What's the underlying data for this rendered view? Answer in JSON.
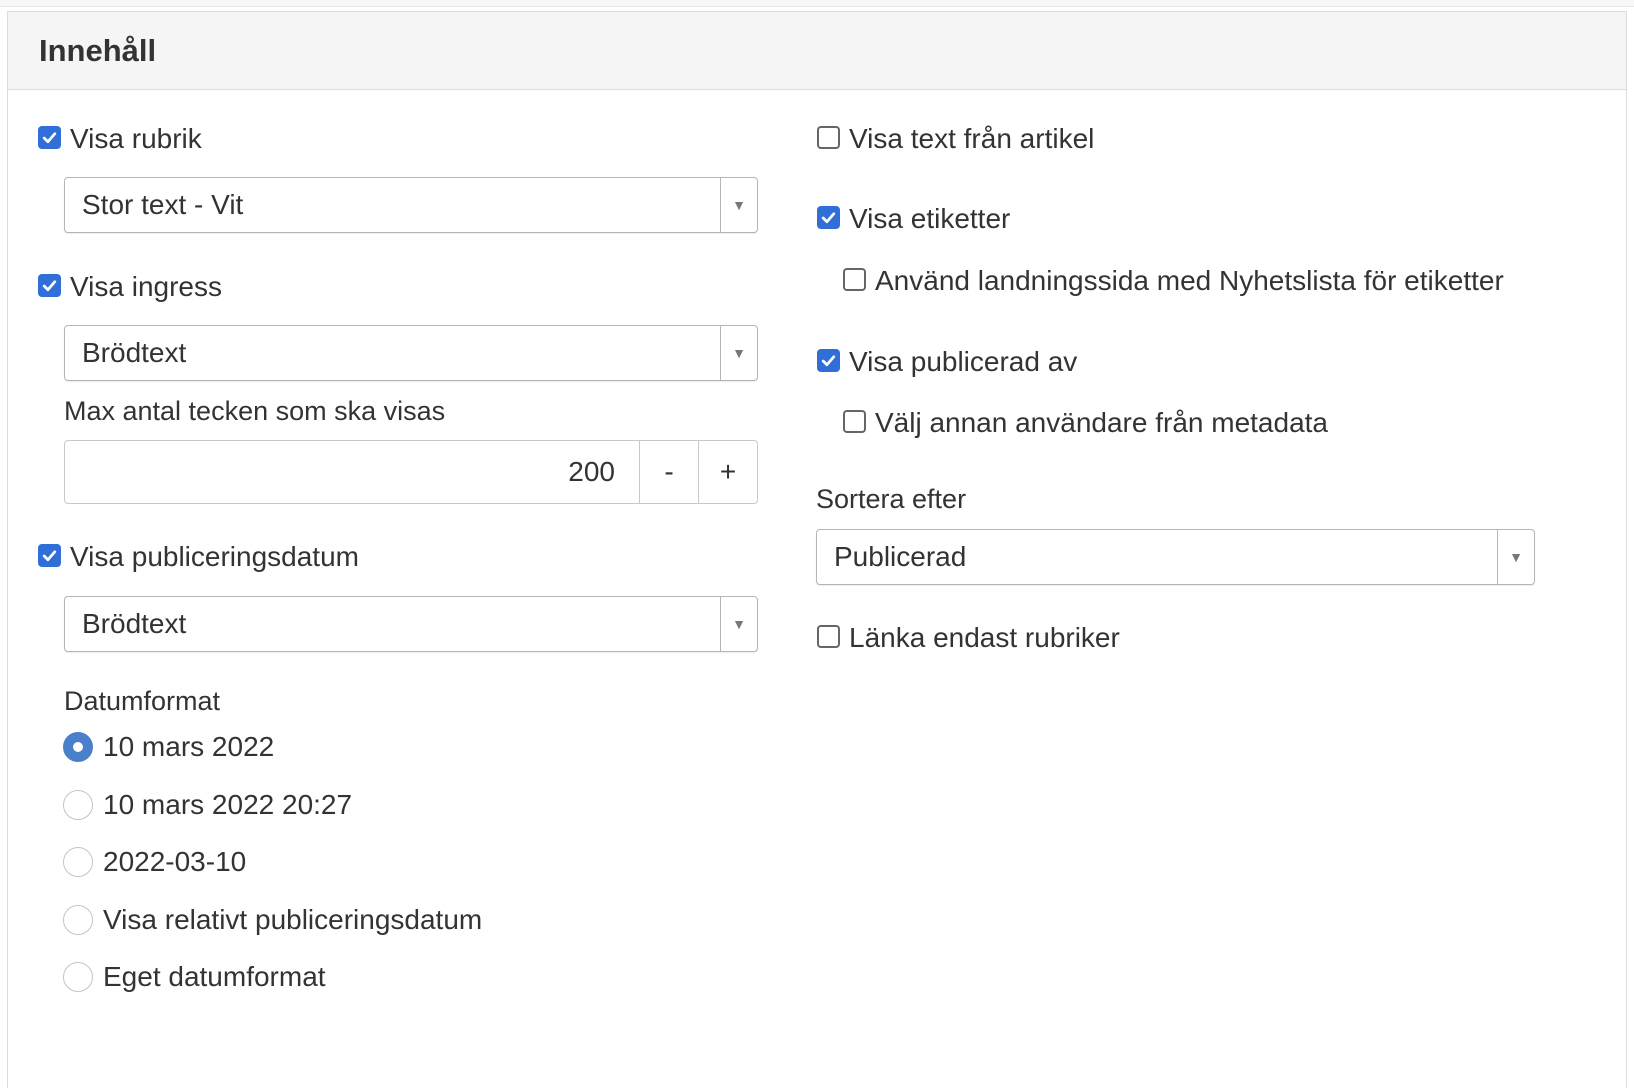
{
  "panel": {
    "title": "Innehåll"
  },
  "left": {
    "show_heading": {
      "label": "Visa rubrik",
      "checked": true
    },
    "heading_style": {
      "value": "Stor text - Vit"
    },
    "show_intro": {
      "label": "Visa ingress",
      "checked": true
    },
    "intro_style": {
      "value": "Brödtext"
    },
    "max_chars": {
      "label": "Max antal tecken som ska visas",
      "value": "200",
      "minus": "-",
      "plus": "+"
    },
    "show_pubdate": {
      "label": "Visa publiceringsdatum",
      "checked": true
    },
    "pubdate_style": {
      "value": "Brödtext"
    },
    "date_format": {
      "label": "Datumformat",
      "options": [
        {
          "label": "10 mars 2022",
          "selected": true
        },
        {
          "label": "10 mars 2022 20:27",
          "selected": false
        },
        {
          "label": "2022-03-10",
          "selected": false
        },
        {
          "label": "Visa relativt publiceringsdatum",
          "selected": false
        },
        {
          "label": "Eget datumformat",
          "selected": false
        }
      ]
    }
  },
  "right": {
    "show_article_text": {
      "label": "Visa text från artikel",
      "checked": false
    },
    "show_tags": {
      "label": "Visa etiketter",
      "checked": true
    },
    "use_landing_page": {
      "label": "Använd landningssida med Nyhetslista för etiketter",
      "checked": false
    },
    "show_published_by": {
      "label": "Visa publicerad av",
      "checked": true
    },
    "choose_other_user": {
      "label": "Välj annan användare från metadata",
      "checked": false
    },
    "sort_by": {
      "label": "Sortera efter",
      "value": "Publicerad"
    },
    "link_only_headings": {
      "label": "Länka endast rubriker",
      "checked": false
    }
  },
  "colors": {
    "checkbox_checked": "#2f6fd7",
    "radio_selected": "#4a7fc9",
    "header_bg": "#f5f5f5"
  }
}
